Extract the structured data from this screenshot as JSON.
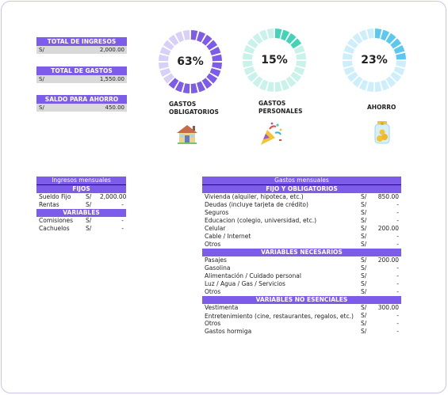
{
  "summary": {
    "income": {
      "label": "TOTAL DE INGRESOS",
      "currency": "S/",
      "value": "2,000.00"
    },
    "expenses": {
      "label": "TOTAL DE GASTOS",
      "currency": "S/",
      "value": "1,550.00"
    },
    "savings": {
      "label": "SALDO PARA AHORRO",
      "currency": "S/",
      "value": "450.00"
    }
  },
  "donuts": [
    {
      "pct_label": "63%",
      "fraction": 0.63,
      "label_1": "GASTOS",
      "label_2": "OBLIGATORIOS",
      "color": "#7c5ce8",
      "track": "#d8d0f8",
      "icon": "house-icon"
    },
    {
      "pct_label": "15%",
      "fraction": 0.15,
      "label_1": "GASTOS",
      "label_2": "PERSONALES",
      "color": "#43d4b8",
      "track": "#c9f2ea",
      "icon": "party-popper-icon"
    },
    {
      "pct_label": "23%",
      "fraction": 0.23,
      "label_1": "AHORRO",
      "label_2": "",
      "color": "#5ac8f0",
      "track": "#cdeefb",
      "icon": "savings-jar-icon"
    }
  ],
  "income_table": {
    "title": "Ingresos mensuales",
    "fixed_header": "FIJOS",
    "fixed_rows": [
      {
        "name": "Sueldo Fijo",
        "currency": "S/",
        "value": "2,000.00"
      },
      {
        "name": "Rentas",
        "currency": "S/",
        "value": "-"
      }
    ],
    "variable_header": "VARIABLES",
    "variable_rows": [
      {
        "name": "Comisiones",
        "currency": "S/",
        "value": "-"
      },
      {
        "name": "Cachuelos",
        "currency": "S/",
        "value": "-"
      }
    ]
  },
  "expense_table": {
    "title": "Gastos mensuales",
    "sections": [
      {
        "header": "FIJO Y OBLIGATORIOS",
        "rows": [
          {
            "name": "Vivienda (alquiler, hipoteca, etc.)",
            "currency": "S/",
            "value": "850.00"
          },
          {
            "name": "Deudas (incluye tarjeta de crédito)",
            "currency": "S/",
            "value": "-"
          },
          {
            "name": "Seguros",
            "currency": "S/",
            "value": "-"
          },
          {
            "name": "Educacion (colegio, universidad, etc.)",
            "currency": "S/",
            "value": "-"
          },
          {
            "name": "Celular",
            "currency": "S/",
            "value": "200.00"
          },
          {
            "name": "Cable / Internet",
            "currency": "S/",
            "value": "-"
          },
          {
            "name": "Otros",
            "currency": "S/",
            "value": "-"
          }
        ]
      },
      {
        "header": "VARIABLES NECESARIOS",
        "rows": [
          {
            "name": "Pasajes",
            "currency": "S/",
            "value": "200.00"
          },
          {
            "name": "Gasolina",
            "currency": "S/",
            "value": "-"
          },
          {
            "name": "Alimentación / Cuidado personal",
            "currency": "S/",
            "value": "-"
          },
          {
            "name": "Luz / Agua / Gas / Servicios",
            "currency": "S/",
            "value": "-"
          },
          {
            "name": "Otros",
            "currency": "S/",
            "value": "-"
          }
        ]
      },
      {
        "header": "VARIABLES NO ESENCIALES",
        "rows": [
          {
            "name": "Vestimenta",
            "currency": "S/",
            "value": "300.00"
          },
          {
            "name": "Entretenimiento (cine, restaurantes, regalos, etc.)",
            "currency": "S/",
            "value": "-"
          },
          {
            "name": "Otros",
            "currency": "S/",
            "value": "-"
          },
          {
            "name": "Gastos hormiga",
            "currency": "S/",
            "value": "-"
          }
        ]
      }
    ]
  }
}
